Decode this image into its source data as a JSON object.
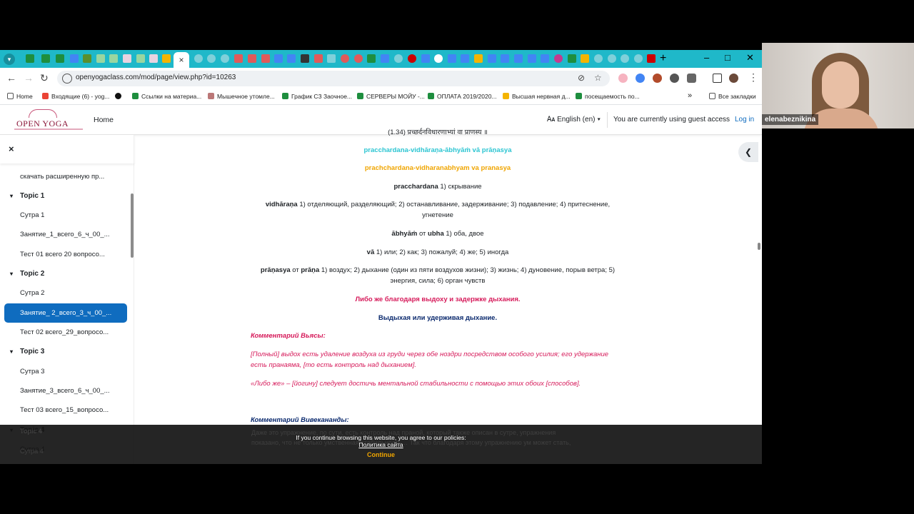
{
  "browser": {
    "active_tab_close": "×",
    "new_tab": "+",
    "window_controls": {
      "minimize": "–",
      "maximize": "□",
      "close": "✕"
    },
    "url": "openyogaclass.com/mod/page/view.php?id=10263",
    "bookmarks": [
      "Home",
      "Входящие (6) - yog...",
      "Ссылки на материа...",
      "Мышечное утомле...",
      "График СЗ Заочное...",
      "СЕРВЕРЫ МОЙУ -...",
      "ОПЛАТА 2019/2020...",
      "Высшая нервная д...",
      "посещаемость по..."
    ],
    "bookmarks_more": "»",
    "all_bookmarks": "Все закладки"
  },
  "site": {
    "logo": "OPEN YOGA",
    "home": "Home",
    "language": "English (en)",
    "guest_text": "You are currently using guest access",
    "login": "Log in"
  },
  "course_index": {
    "close": "×",
    "items": {
      "download": "скачать расширенную пр...",
      "topic1": "Topic 1",
      "t1_sutra": "Сутра 1",
      "t1_lesson": "Занятие_1_всего_6_ч_00_...",
      "t1_test": "Тест 01 всего 20 вопросо...",
      "topic2": "Topic 2",
      "t2_sutra": "Сутра 2",
      "t2_lesson": "Занятие_ 2_всего_3_ч_00_...",
      "t2_test": "Тест 02 всего_29_вопросо...",
      "topic3": "Topic 3",
      "t3_sutra": "Сутра 3",
      "t3_lesson": "Занятие_3_всего_6_ч_00_...",
      "t3_test": "Тест 03 всего_15_вопросо...",
      "topic4": "Topic 4",
      "t4_sutra": "Сутра 4"
    }
  },
  "content": {
    "cut_line": "(1.34) प्रच्छर्दनविधारणाभ्यां वा प्राणस्य ॥",
    "translit1": "pracchardana-vidhāraṇa-ābhyāṁ vā prāṇasya",
    "translit2": "prachchardana-vidharanabhyam va pranasya",
    "w1_term": "pracchardana",
    "w1_def": " 1) скрывание",
    "w2_term": "vidhāraṇa",
    "w2_def": " 1) отделяющий, разделяющий; 2) останавливание, задерживание; 3) подавление; 4) притеснение, угнетение",
    "w3_term": "ābhyāṁ",
    "w3_mid": " от ",
    "w3_term2": "ubha",
    "w3_def": " 1) оба, двое",
    "w4_term": "vā",
    "w4_def": " 1) или; 2) как; 3) пожалуй; 4) же; 5) иногда",
    "w5_term": "prāṇasya",
    "w5_mid": " от ",
    "w5_term2": "prāṇa",
    "w5_def": " 1) воздух; 2) дыхание (один из пяти воздухов жизни); 3) жизнь; 4) дуновение, порыв ветра; 5) энергия, сила; 6) орган чувств",
    "translation1": "Либо же благодаря выдоху и задержке дыхания.",
    "translation2": "Выдыхая или удерживая дыхание.",
    "vyasa_title": "Комментарий Вьясы:",
    "vyasa_p1": "[Полный] выдох есть удаление воздуха из груди через обе ноздри посредством особого усилия; его удержание есть пранаяма, [то есть контроль над дыханием].",
    "vyasa_p2": "«Либо же» – [йогину] следует достичь ментальной стабильности с помощью этих обоих [способов].",
    "vivek_title": "Комментарий Вивекананды:",
    "faded_line1": "Даже это упражнение, по сути, есть контроль над праной, который также описан в сутре, упражнения",
    "faded_line2": "показано, что не только умственная стабильность… Так что благодаря этому упражнению ум может стать,"
  },
  "cookie": {
    "text": "If you continue browsing this website, you agree to our policies:",
    "link": "Политика сайта",
    "button": "Continue"
  },
  "webcam": {
    "name": "elenabeznikina"
  },
  "colors": {
    "tabstrip": "#1fb8c9",
    "accent": "#0f6cbf",
    "translit_cyan": "#2cc5d2",
    "translit_orange": "#f0a500",
    "crimson": "#d61a5a",
    "navy": "#0b2a6e"
  }
}
